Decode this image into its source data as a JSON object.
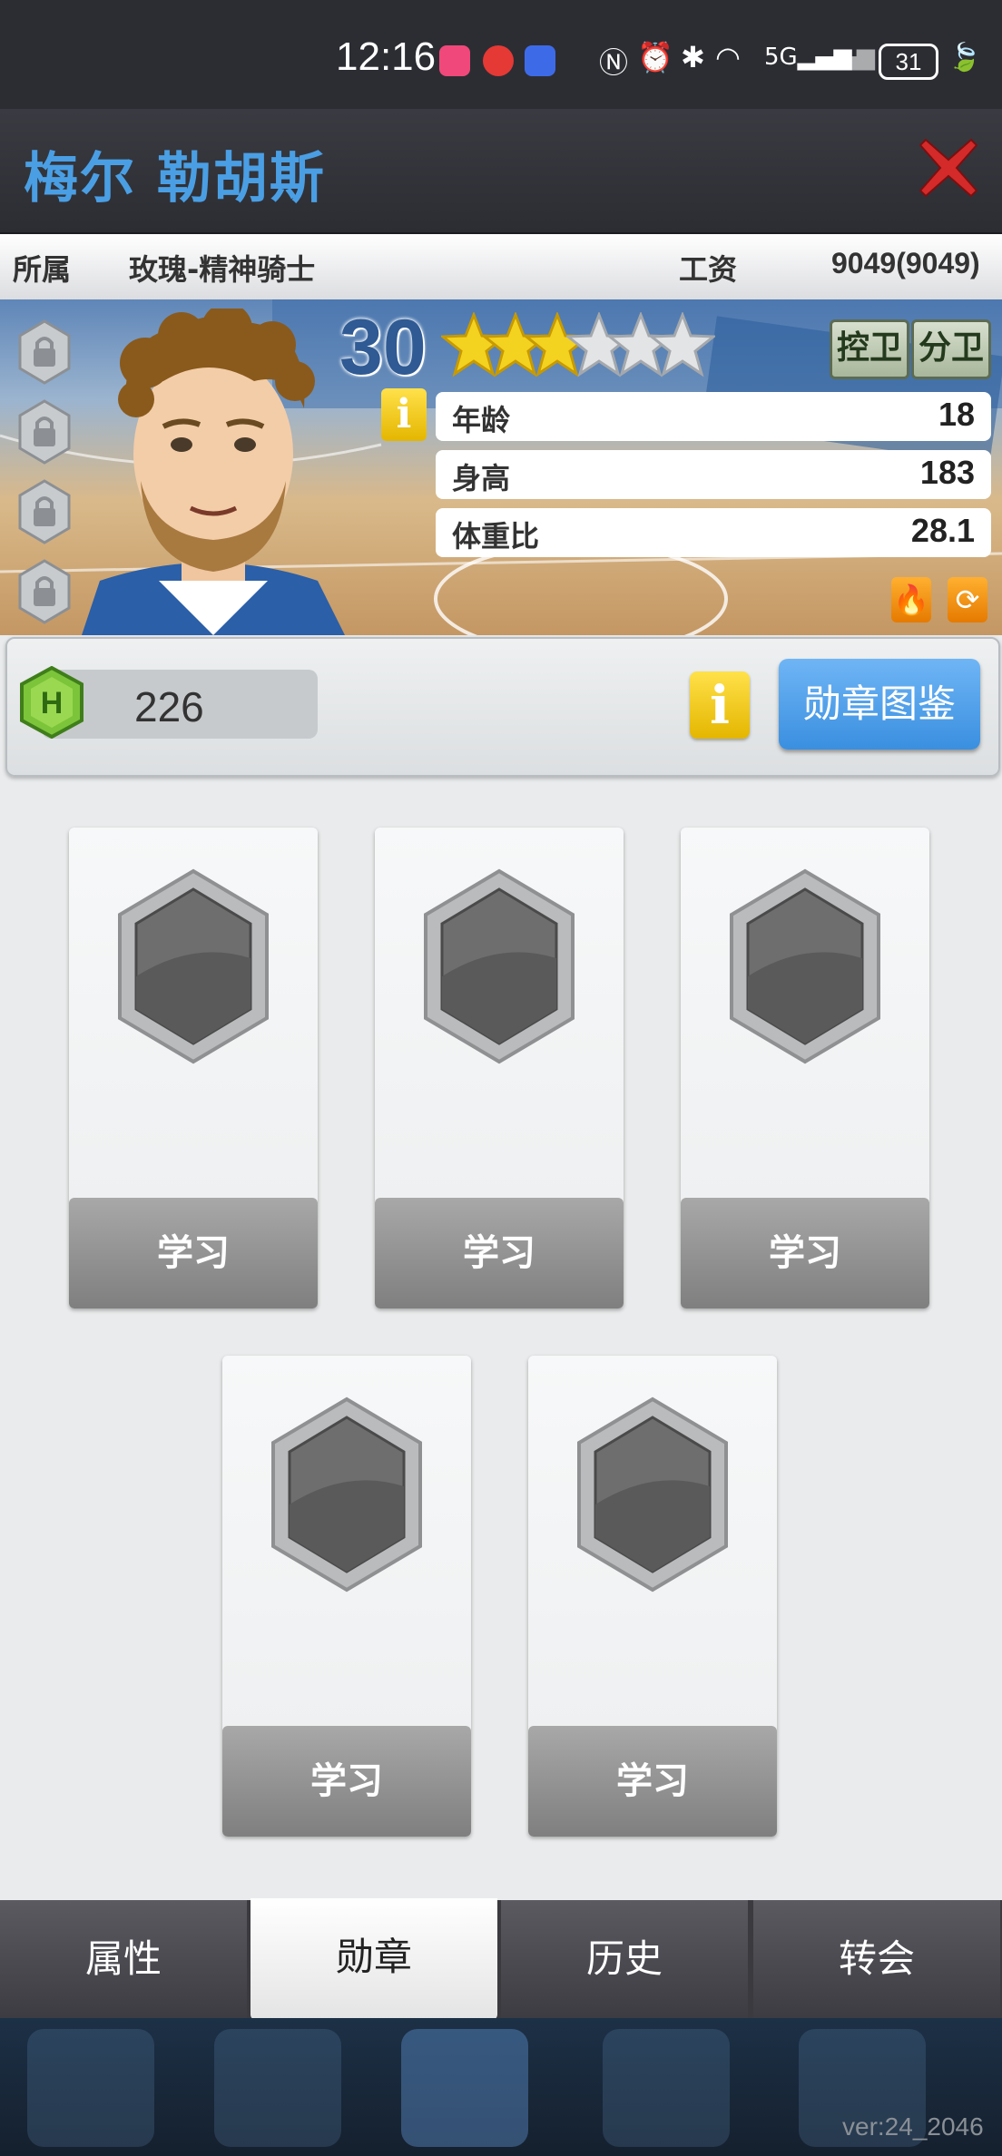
{
  "status_bar": {
    "time": "12:16",
    "battery": "31"
  },
  "header": {
    "title": "梅尔 勒胡斯"
  },
  "info_row": {
    "team_label": "所属",
    "team_value": "玫瑰-精神骑士",
    "salary_label": "工资",
    "salary_value": "9049(9049)"
  },
  "player": {
    "rating": "30",
    "stars_filled": 3,
    "stars_total": 6,
    "positions": [
      "控卫",
      "分卫"
    ],
    "stats": [
      {
        "label": "年龄",
        "value": "18"
      },
      {
        "label": "身高",
        "value": "183"
      },
      {
        "label": "体重比",
        "value": "28.1"
      }
    ]
  },
  "badges": {
    "points": "226",
    "book_button": "勋章图鉴",
    "slots": [
      {
        "button": "学习"
      },
      {
        "button": "学习"
      },
      {
        "button": "学习"
      },
      {
        "button": "学习"
      },
      {
        "button": "学习"
      }
    ]
  },
  "tabs": [
    {
      "label": "属性"
    },
    {
      "label": "勋章"
    },
    {
      "label": "历史"
    },
    {
      "label": "转会"
    }
  ],
  "active_tab": "勋章",
  "footer": {
    "version": "ver:24_2046"
  },
  "colors": {
    "title": "#4a9fe4",
    "primary_button": "#3a8fe0",
    "star": "#f4d220",
    "close": "#d42a2a"
  }
}
